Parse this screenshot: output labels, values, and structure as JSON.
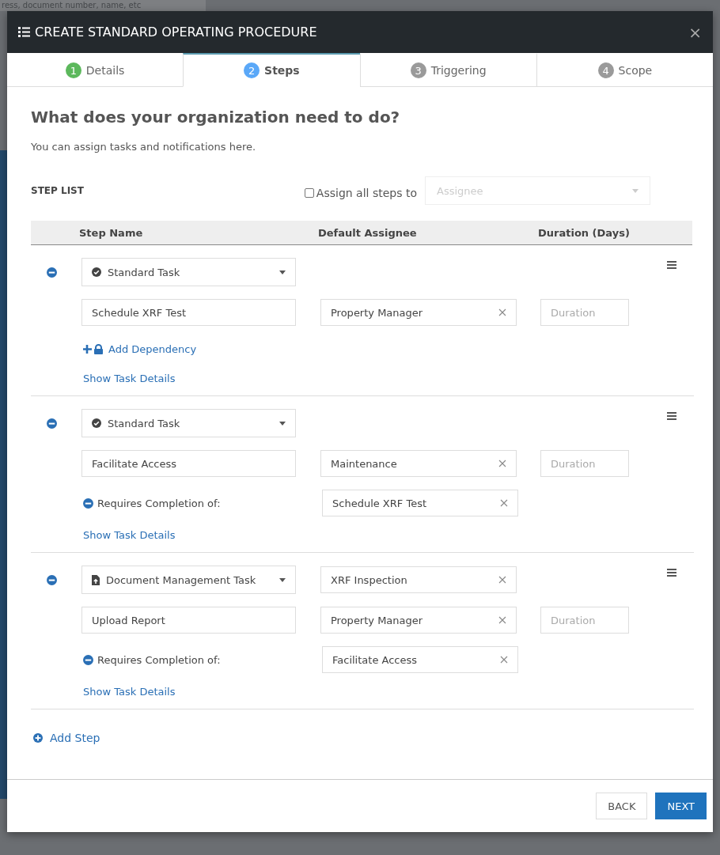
{
  "background": {
    "search_text": "ress, document number, name, etc"
  },
  "dialog": {
    "title": "CREATE STANDARD OPERATING PROCEDURE",
    "close": "×"
  },
  "tabs": [
    {
      "number": "1",
      "label": "Details",
      "selected": false,
      "color": "#5cb85c"
    },
    {
      "number": "2",
      "label": "Steps",
      "selected": true,
      "color": "#5aa8f8"
    },
    {
      "number": "3",
      "label": "Triggering",
      "selected": false,
      "color": "#9a9a9a"
    },
    {
      "number": "4",
      "label": "Scope",
      "selected": false,
      "color": "#9a9a9a"
    }
  ],
  "heading": "What does your organization need to do?",
  "subheading": "You can assign tasks and notifications here.",
  "step_list": {
    "label": "STEP LIST",
    "assign_all": {
      "label": "Assign all steps to",
      "checked": false,
      "placeholder": "Assignee"
    }
  },
  "columns": [
    "Step Name",
    "Default Assignee",
    "Duration (Days)"
  ],
  "steps": [
    {
      "task_type": {
        "kind": "standard",
        "label": "Standard Task"
      },
      "name": "Schedule XRF Test",
      "assignee": "Property Manager",
      "duration_placeholder": "Duration",
      "dependency": {
        "kind": "add",
        "label": "Add Dependency"
      },
      "details_link": "Show Task Details"
    },
    {
      "task_type": {
        "kind": "standard",
        "label": "Standard Task"
      },
      "name": "Facilitate Access",
      "assignee": "Maintenance",
      "duration_placeholder": "Duration",
      "dependency": {
        "kind": "requires",
        "label": "Requires Completion of:",
        "value": "Schedule XRF Test"
      },
      "details_link": "Show Task Details"
    },
    {
      "task_type": {
        "kind": "document",
        "label": "Document Management Task",
        "document": "XRF Inspection"
      },
      "name": "Upload Report",
      "assignee": "Property Manager",
      "duration_placeholder": "Duration",
      "dependency": {
        "kind": "requires",
        "label": "Requires Completion of:",
        "value": "Facilitate Access"
      },
      "details_link": "Show Task Details"
    }
  ],
  "add_step": "Add Step",
  "buttons": [
    {
      "kind": "secondary",
      "label": "BACK"
    },
    {
      "kind": "primary",
      "label": "NEXT"
    }
  ]
}
